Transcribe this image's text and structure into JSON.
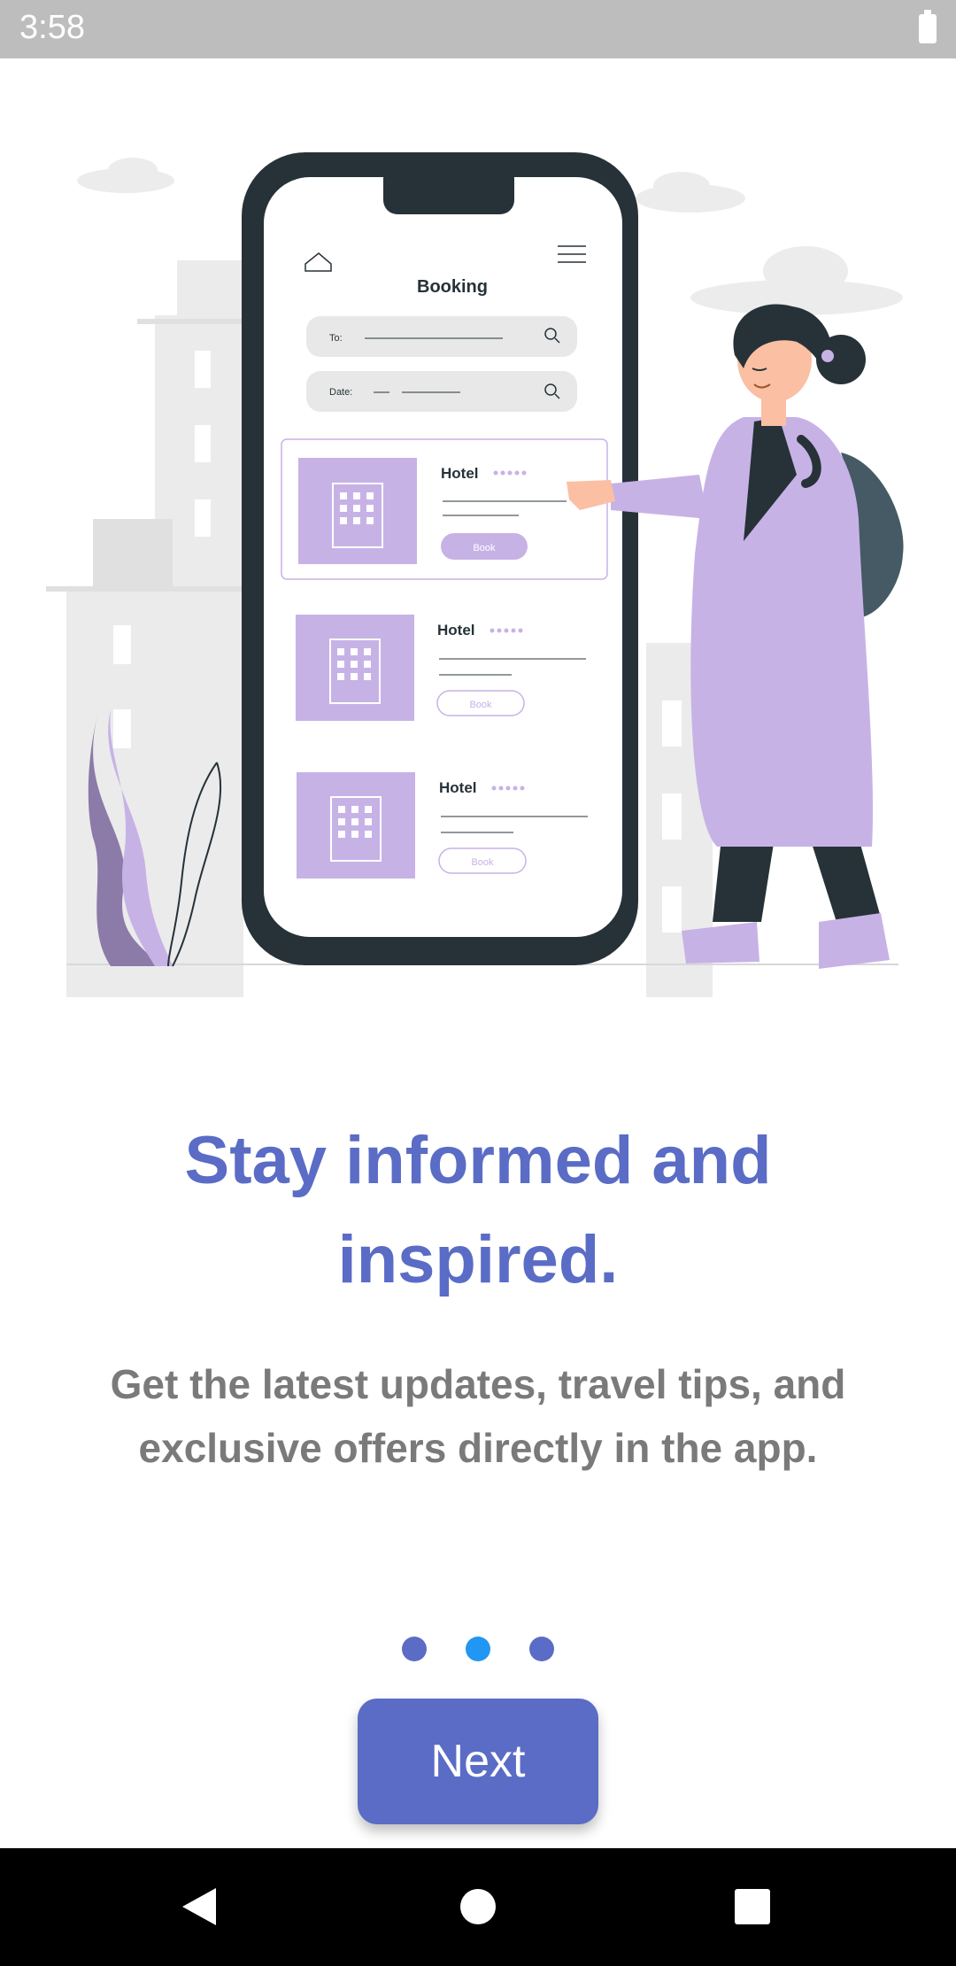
{
  "status_bar": {
    "time": "3:58",
    "battery_icon": "battery-full-icon"
  },
  "illustration": {
    "phone_screen": {
      "title": "Booking",
      "search_fields": [
        {
          "label": "To:"
        },
        {
          "label": "Date:"
        }
      ],
      "hotels": [
        {
          "name": "Hotel",
          "button": "Book"
        },
        {
          "name": "Hotel",
          "button": "Book"
        },
        {
          "name": "Hotel",
          "button": "Book"
        }
      ]
    }
  },
  "onboarding": {
    "title_line1": "Stay informed and",
    "title_line2": "inspired.",
    "subtitle_line1": "Get the latest updates, travel tips, and",
    "subtitle_line2": "exclusive offers directly in the app.",
    "current_page": 2,
    "page_count": 3,
    "next_label": "Next"
  },
  "nav_bar": {
    "back": "back-triangle-icon",
    "home": "home-circle-icon",
    "recents": "recents-square-icon"
  },
  "colors": {
    "accent": "#5a6cc5",
    "active_dot": "#2196f3",
    "lavender": "#c7b2e6",
    "dark": "#263238",
    "subtitle_text": "#7a7a7a"
  }
}
